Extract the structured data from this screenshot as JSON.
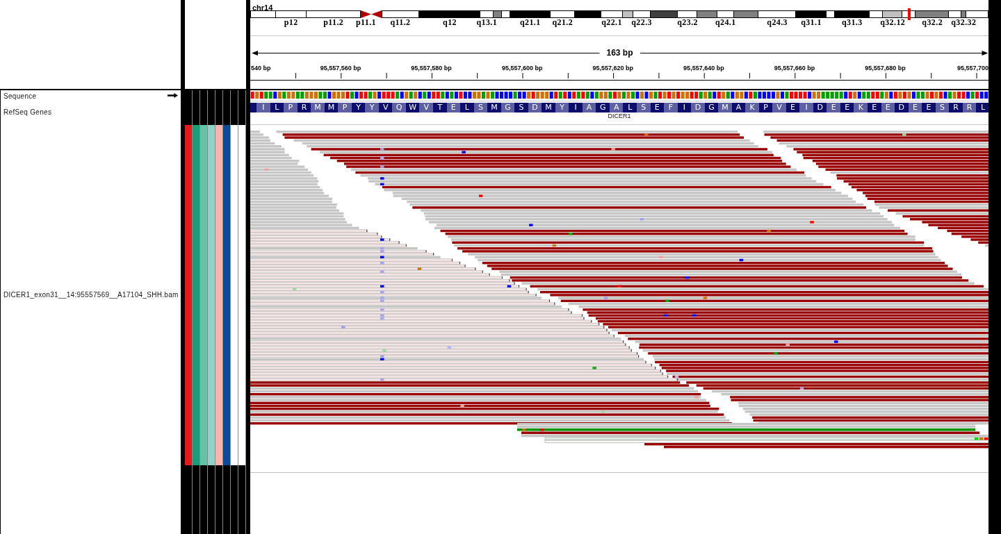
{
  "name_panel": {
    "tracks": [
      {
        "name": "Sequence",
        "kind": "sequence",
        "forward_strand": true
      },
      {
        "name": "RefSeq Genes",
        "kind": "gene"
      },
      {
        "name": "DICER1_exon31__14:95557569__A17104_SHH.bam",
        "kind": "alignment"
      }
    ]
  },
  "attribute_panel": {
    "columns": [
      {
        "color": "#e41a1c"
      },
      {
        "color": "#1b9e77"
      },
      {
        "color": "#66c2a5"
      },
      {
        "color": "#8dd3c7"
      },
      {
        "color": "#fbb4ae"
      },
      {
        "color": "#0b4a97"
      },
      {
        "color": "#ffffff"
      },
      {
        "color": "#ffffff"
      }
    ]
  },
  "chromosome": {
    "name": "chr14",
    "bands": [
      {
        "color": "#ffffff",
        "kind": "band",
        "selected": false
      },
      {
        "label": "p12",
        "color": "#ffffff",
        "kind": "band",
        "selected": false
      },
      {
        "label": "p11.2",
        "color": "#ffffff",
        "kind": "band",
        "selected": false
      },
      {
        "label": "p11.1",
        "color": "#b20000",
        "kind": "centromere_p",
        "selected": false
      },
      {
        "color": "#b20000",
        "kind": "centromere_q",
        "selected": false
      },
      {
        "label": "q11.2",
        "color": "#ffffff",
        "kind": "band",
        "selected": false
      },
      {
        "label": "q12",
        "color": "#000000",
        "kind": "band",
        "selected": false
      },
      {
        "label": "q13.1",
        "color": "#ffffff",
        "kind": "band",
        "selected": false
      },
      {
        "color": "#808080",
        "kind": "band",
        "selected": false
      },
      {
        "color": "#ffffff",
        "kind": "band",
        "selected": false
      },
      {
        "label": "q21.1",
        "color": "#000000",
        "kind": "band",
        "selected": false
      },
      {
        "label": "q21.2",
        "color": "#ffffff",
        "kind": "band",
        "selected": false
      },
      {
        "color": "#000000",
        "kind": "band",
        "selected": false
      },
      {
        "label": "q22.1",
        "color": "#ffffff",
        "kind": "band",
        "selected": false
      },
      {
        "color": "#c0c0c0",
        "kind": "band",
        "selected": false
      },
      {
        "label": "q22.3",
        "color": "#ffffff",
        "kind": "band",
        "selected": false
      },
      {
        "color": "#404040",
        "kind": "band",
        "selected": false
      },
      {
        "label": "q23.2",
        "color": "#ffffff",
        "kind": "band",
        "selected": false
      },
      {
        "color": "#808080",
        "kind": "band",
        "selected": false
      },
      {
        "label": "q24.1",
        "color": "#ffffff",
        "kind": "band",
        "selected": false
      },
      {
        "color": "#808080",
        "kind": "band",
        "selected": false
      },
      {
        "label": "q24.3",
        "color": "#ffffff",
        "kind": "band",
        "selected": false
      },
      {
        "label": "q31.1",
        "color": "#000000",
        "kind": "band",
        "selected": false
      },
      {
        "color": "#ffffff",
        "kind": "band",
        "selected": false
      },
      {
        "label": "q31.3",
        "color": "#000000",
        "kind": "band",
        "selected": false
      },
      {
        "color": "#ffffff",
        "kind": "band",
        "selected": false
      },
      {
        "label": "q32.12",
        "color": "#c0c0c0",
        "kind": "band",
        "selected": false
      },
      {
        "color": "#ffffff",
        "kind": "band",
        "selected": true
      },
      {
        "label": "q32.2",
        "color": "#808080",
        "kind": "band",
        "selected": false
      },
      {
        "color": "#ffffff",
        "kind": "band",
        "selected": false
      },
      {
        "label": "q32.32",
        "color": "#808080",
        "kind": "band",
        "selected": false
      },
      {
        "color": "#ffffff",
        "kind": "band",
        "selected": false
      }
    ]
  },
  "ruler": {
    "span": "163 bp",
    "ticks": [
      "540 bp",
      "95,557,560 bp",
      "95,557,580 bp",
      "95,557,600 bp",
      "95,557,620 bp",
      "95,557,640 bp",
      "95,557,660 bp",
      "95,557,680 bp",
      "95,557,700"
    ]
  },
  "gene_track": {
    "amino_acids": [
      "I",
      "L",
      "P",
      "R",
      "M",
      "M",
      "P",
      "Y",
      "Y",
      "V",
      "Q",
      "W",
      "V",
      "T",
      "E",
      "L",
      "S",
      "M",
      "G",
      "S",
      "D",
      "M",
      "Y",
      "I",
      "A",
      "G",
      "A",
      "L",
      "S",
      "E",
      "F",
      "I",
      "D",
      "G",
      "M",
      "A",
      "K",
      "P",
      "V",
      "E",
      "I",
      "D",
      "E",
      "E",
      "K",
      "E",
      "E",
      "D",
      "E",
      "E",
      "S",
      "R",
      "R",
      "L"
    ],
    "gene_name": "DICER1"
  }
}
